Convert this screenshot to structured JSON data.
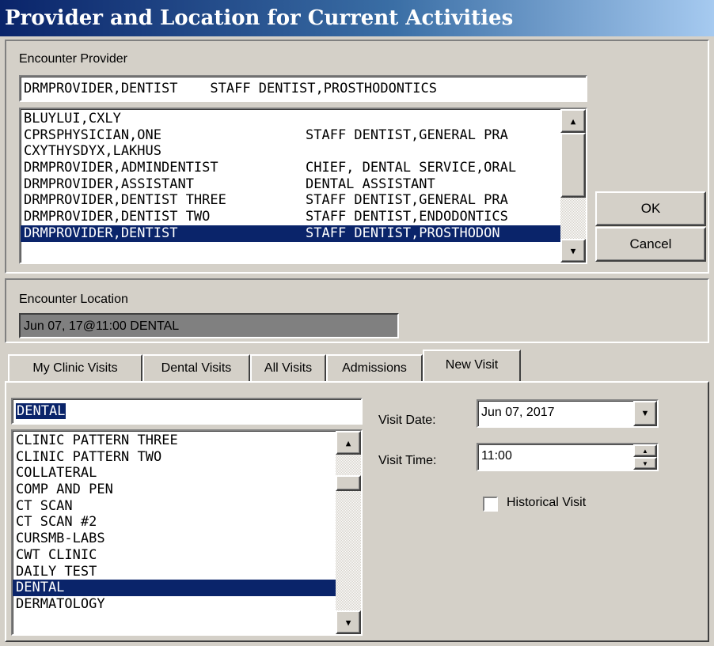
{
  "window": {
    "title": "Provider and Location for Current Activities"
  },
  "provider": {
    "label": "Encounter Provider",
    "input_value": "DRMPROVIDER,DENTIST    STAFF DENTIST,PROSTHODONTICS",
    "list": [
      {
        "name": "BLUYLUI,CXLY",
        "title": ""
      },
      {
        "name": "CPRSPHYSICIAN,ONE",
        "title": "STAFF DENTIST,GENERAL PRA"
      },
      {
        "name": "CXYTHYSDYX,LAKHUS",
        "title": ""
      },
      {
        "name": "DRMPROVIDER,ADMINDENTIST",
        "title": "CHIEF, DENTAL SERVICE,ORAL"
      },
      {
        "name": "DRMPROVIDER,ASSISTANT",
        "title": "DENTAL ASSISTANT"
      },
      {
        "name": "DRMPROVIDER,DENTIST THREE",
        "title": "STAFF DENTIST,GENERAL PRA"
      },
      {
        "name": "DRMPROVIDER,DENTIST TWO",
        "title": "STAFF DENTIST,ENDODONTICS"
      },
      {
        "name": "DRMPROVIDER,DENTIST",
        "title": "STAFF DENTIST,PROSTHODON"
      }
    ],
    "selected_index": 7
  },
  "buttons": {
    "ok": "OK",
    "cancel": "Cancel"
  },
  "location": {
    "label": "Encounter Location",
    "value": "Jun 07, 17@11:00 DENTAL"
  },
  "tabs": [
    "My Clinic Visits",
    "Dental Visits",
    "All Visits",
    "Admissions",
    "New Visit"
  ],
  "active_tab": 4,
  "new_visit": {
    "search_value": "DENTAL",
    "clinics": [
      "CLINIC PATTERN THREE",
      "CLINIC PATTERN TWO",
      "COLLATERAL",
      "COMP AND PEN",
      "CT SCAN",
      "CT SCAN #2",
      "CURSMB-LABS",
      "CWT CLINIC",
      "DAILY TEST",
      "DENTAL",
      "DERMATOLOGY"
    ],
    "selected_index": 9,
    "visit_date_label": "Visit Date:",
    "visit_date_value": "Jun 07, 2017",
    "visit_time_label": "Visit Time:",
    "visit_time_value": "11:00",
    "historical_label": "Historical Visit",
    "historical_checked": false
  },
  "icons": {
    "scroll_up": "scroll-up-arrow-icon",
    "scroll_down": "scroll-down-arrow-icon",
    "dropdown": "chevron-down-icon",
    "spin": "spin-arrows-icon"
  }
}
